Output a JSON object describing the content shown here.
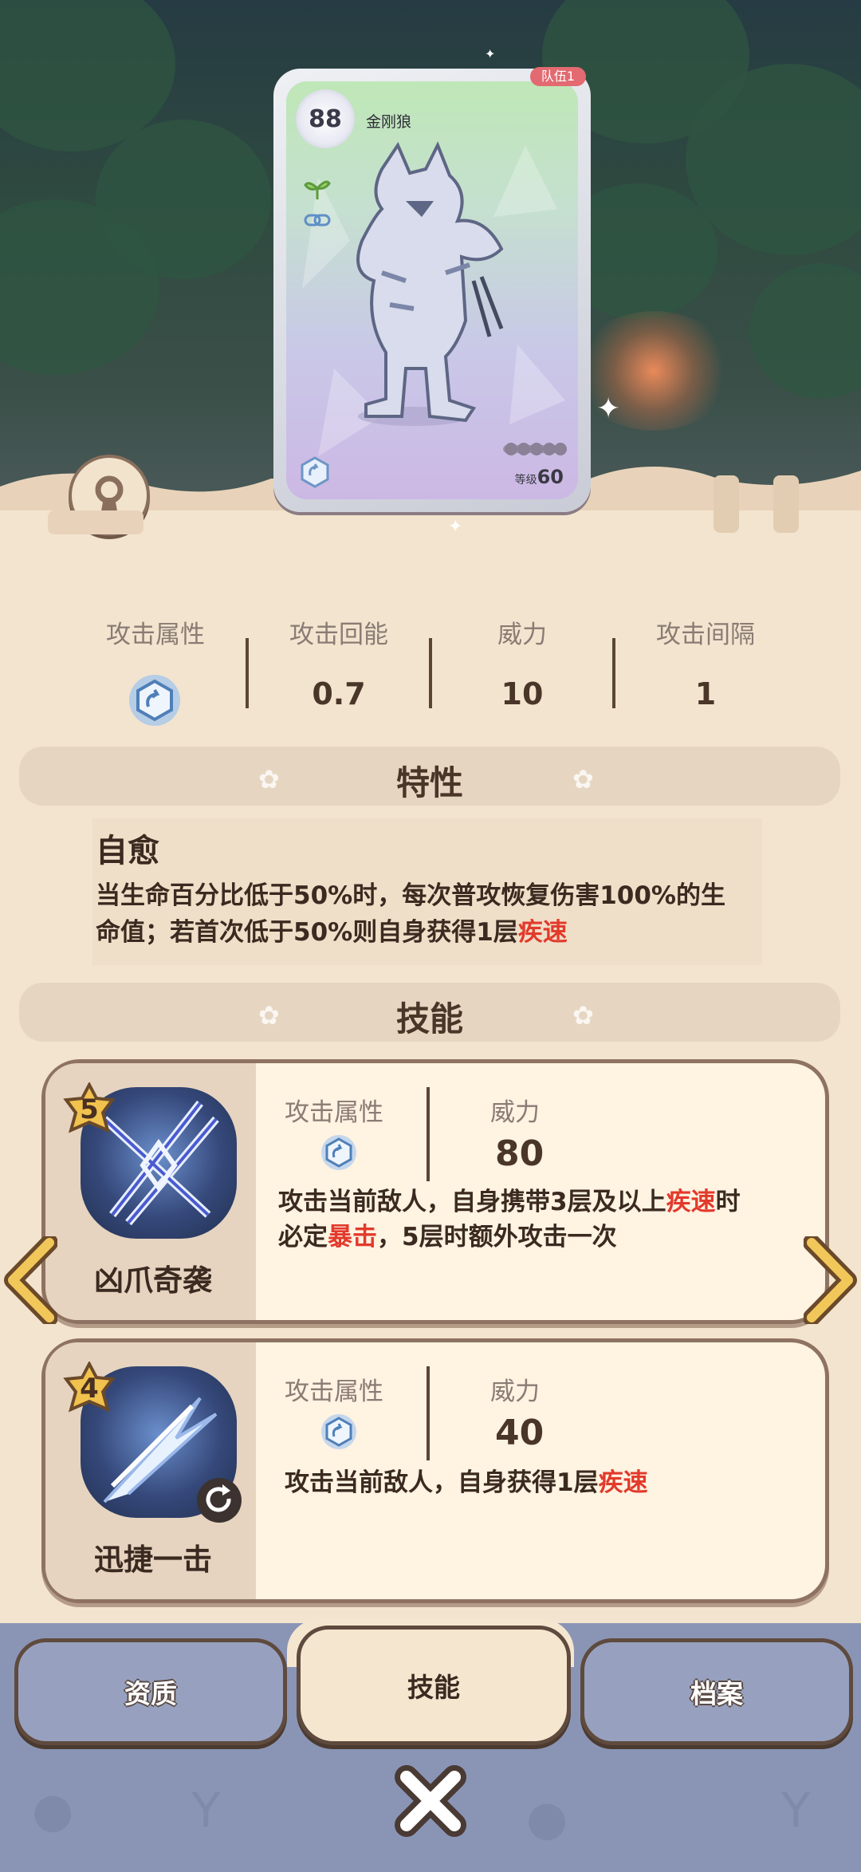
{
  "card": {
    "level_badge": "88",
    "team": "队伍1",
    "name": "金刚狼",
    "level_label": "等级",
    "level_value": "60"
  },
  "stats": [
    {
      "label": "攻击属性",
      "value": ""
    },
    {
      "label": "攻击回能",
      "value": "0.7"
    },
    {
      "label": "威力",
      "value": "10"
    },
    {
      "label": "攻击间隔",
      "value": "1"
    }
  ],
  "trait_header": "特性",
  "trait": {
    "name": "自愈",
    "desc_line1": "当生命百分比低于50%时，每次普攻恢复伤害100%的生",
    "desc_line2_pre": "命值；若首次低于50%则自身获得1层",
    "desc_line2_red": "疾速"
  },
  "skill_header": "技能",
  "skills": [
    {
      "cost": "5",
      "name": "凶爪奇袭",
      "attr_label": "攻击属性",
      "power_label": "威力",
      "power": "80",
      "d1_a": "攻击当前敌人，自身携带3层及以上",
      "d1_red": "疾速",
      "d1_b": "时",
      "d2_a": "必定",
      "d2_red": "暴击",
      "d2_b": "，5层时额外攻击一次"
    },
    {
      "cost": "4",
      "name": "迅捷一击",
      "attr_label": "攻击属性",
      "power_label": "威力",
      "power": "40",
      "d1_a": "攻击当前敌人，自身获得1层",
      "d1_red": "疾速"
    }
  ],
  "tabs": {
    "left": "资质",
    "center": "技能",
    "right": "档案"
  },
  "colors": {
    "panel": "#f3e4cf",
    "accent_red": "#e23a2c",
    "nav": "#8a95b5"
  }
}
